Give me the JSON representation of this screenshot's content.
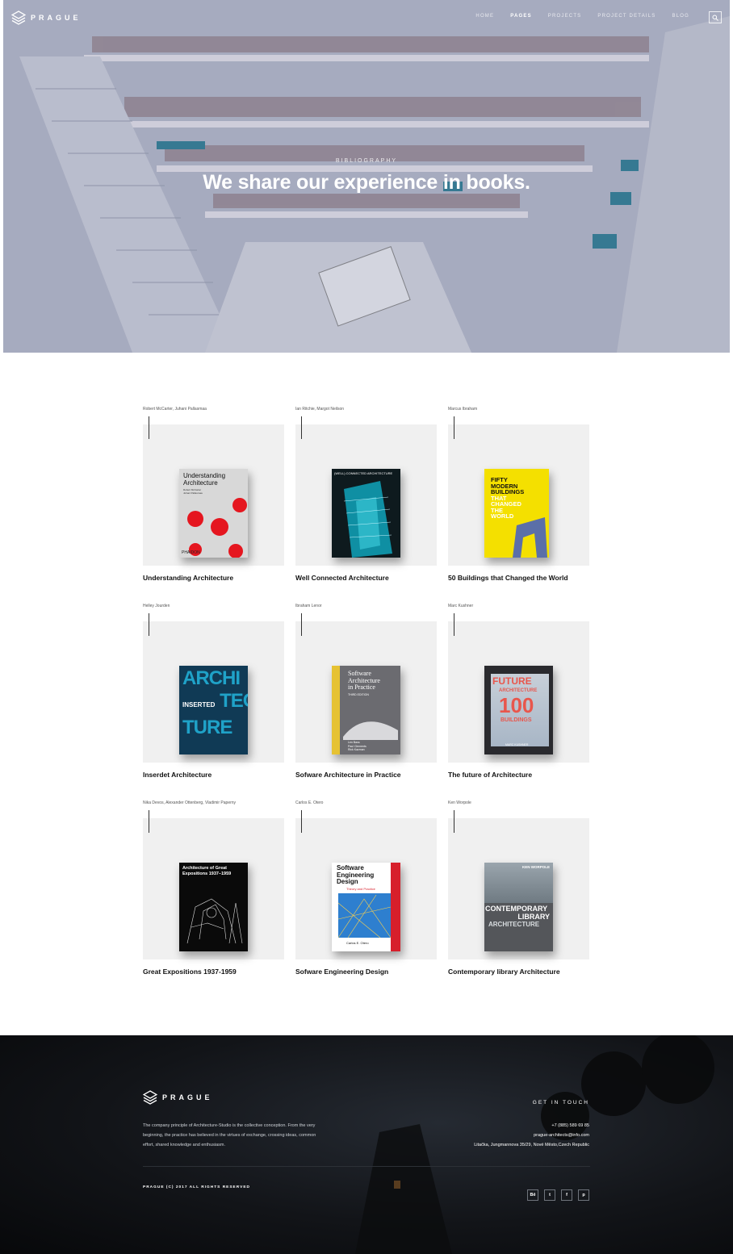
{
  "header": {
    "brand": "PRAGUE",
    "nav": [
      {
        "label": "HOME",
        "active": false
      },
      {
        "label": "PAGES",
        "active": true
      },
      {
        "label": "PROJECTS",
        "active": false
      },
      {
        "label": "PROJECT DETAILS",
        "active": false
      },
      {
        "label": "BLOG",
        "active": false
      }
    ],
    "search_icon": "search-icon"
  },
  "hero": {
    "kicker": "BIBLIOGRAPHY",
    "title": "We share our experience in books."
  },
  "books": [
    {
      "authors": "Robert McCarter, Juhani Pallasmaa",
      "title": "Understanding Architecture"
    },
    {
      "authors": "Ian Ritchie, Margot Neilson",
      "title": "Well Connected Architecture"
    },
    {
      "authors": "Marcus Ibraham",
      "title": "50 Buildings that Changed the World"
    },
    {
      "authors": "Helley Jourden",
      "title": "Inserdet Architecture"
    },
    {
      "authors": "Ibraham Lenor",
      "title": "Sofware Architecture in Practice"
    },
    {
      "authors": "Marc Kushner",
      "title": "The future of Architecture"
    },
    {
      "authors": "Nika Devos, Alexander Ottenberg, Vladimir Paperny",
      "title": "Great Expositions 1937-1959"
    },
    {
      "authors": "Carlos E. Otero",
      "title": "Sofware Engineering Design"
    },
    {
      "authors": "Ken Worpole",
      "title": "Contemporary library Architecture"
    }
  ],
  "covers": {
    "c1": {
      "l1": "Understanding",
      "l2": "Architecture",
      "sub": "Robert McCarter\nJuhani Pallasmaa",
      "pub": "PHAIDON"
    },
    "c2": {
      "l1": "(WELL) CONNECTED ARCHITECTURE"
    },
    "c3": {
      "l1": "FIFTY",
      "l2": "MODERN",
      "l3": "BUILDINGS",
      "l4": "THAT",
      "l5": "CHANGED",
      "l6": "THE",
      "l7": "WORLD"
    },
    "c4": {
      "l1": "ARCHI",
      "l2": "INSERTED",
      "l3": "TEC",
      "l4": "TURE"
    },
    "c5": {
      "l1": "Software",
      "l2": "Architecture",
      "l3": "in Practice",
      "l4": "THIRD EDITION",
      "a1": "Len Bass",
      "a2": "Paul Clements",
      "a3": "Rick Kazman"
    },
    "c6": {
      "l1": "FUTURE",
      "l2": "ARCHITECTURE",
      "l3": "100",
      "l4": "BUILDINGS",
      "a1": "MARC KUSHNER"
    },
    "c7": {
      "l1": "Architecture of Great",
      "l2": "Expositions 1937–1959"
    },
    "c8": {
      "l1": "Software",
      "l2": "Engineering",
      "l3": "Design",
      "l4": "Theory and Practice",
      "a1": "Carlos E. Otero"
    },
    "c9": {
      "l1": "KEN WORPOLE",
      "l2": "CONTEMPORARY",
      "l3": "LIBRARY",
      "l4": "ARCHITECTURE"
    }
  },
  "footer": {
    "brand": "PRAGUE",
    "description": "The company principle of Architecture-Studio is the collective conception. From the very beginning, the practice has believed in the virtues of exchange, crossing ideas, common effort, shared knowledge and enthusiasm.",
    "touch_title": "GET IN TOUCH",
    "phone": "+7 (885) 589 69 85",
    "email": "prague-architects@info.com",
    "address": "Litačka, Jungmannova 35/29, Nové Město,Czech Republic",
    "copyright": "PRAGUE (C) 2017 ALL RIGHTS RESERVED",
    "socials": [
      {
        "label": "Bē",
        "icon": "behance-icon"
      },
      {
        "label": "t",
        "icon": "twitter-icon"
      },
      {
        "label": "f",
        "icon": "facebook-icon"
      },
      {
        "label": "p",
        "icon": "pinterest-icon"
      }
    ]
  }
}
